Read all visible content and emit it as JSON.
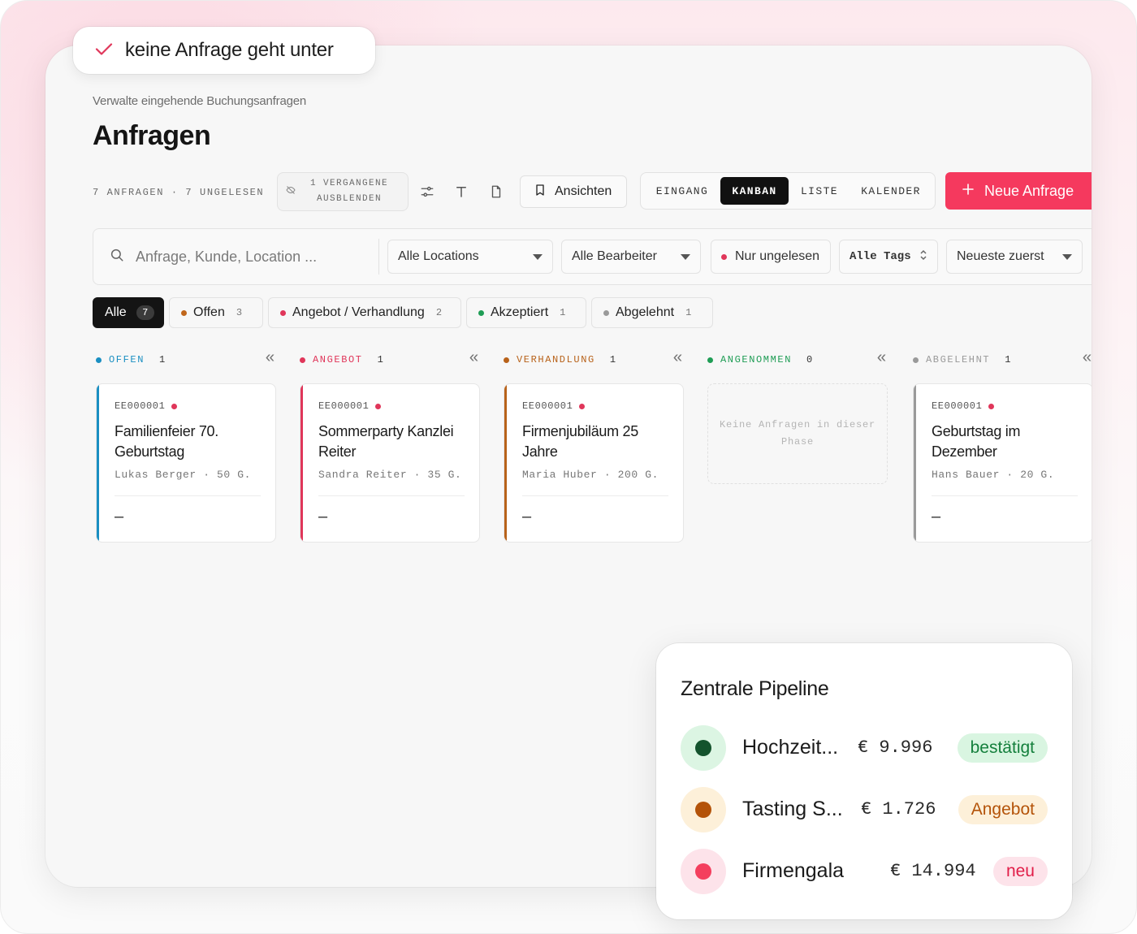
{
  "badge": {
    "text": "keine Anfrage geht unter"
  },
  "header": {
    "subtitle": "Verwalte eingehende Buchungsanfragen",
    "title": "Anfragen"
  },
  "toolbar": {
    "counts": "7 ANFRAGEN · 7 UNGELESEN",
    "hide_past": "1 VERGANGENE\nAUSBLENDEN",
    "views_label": "Ansichten",
    "tabs": [
      "EINGANG",
      "KANBAN",
      "LISTE",
      "KALENDER"
    ],
    "active_tab": "KANBAN",
    "new_label": "Neue Anfrage"
  },
  "filters": {
    "search_placeholder": "Anfrage, Kunde, Location ...",
    "location": "Alle Locations",
    "editor": "Alle Bearbeiter",
    "unread": "Nur ungelesen",
    "tags": "Alle Tags",
    "sort": "Neueste zuerst"
  },
  "chips": [
    {
      "label": "Alle",
      "count": "7",
      "color": ""
    },
    {
      "label": "Offen",
      "count": "3",
      "color": "#c0661b"
    },
    {
      "label": "Angebot / Verhandlung",
      "count": "2",
      "color": "#e0365a"
    },
    {
      "label": "Akzeptiert",
      "count": "1",
      "color": "#1f9d55"
    },
    {
      "label": "Abgelehnt",
      "count": "1",
      "color": "#9a9a9a"
    }
  ],
  "columns": [
    {
      "name": "OFFEN",
      "count": "1",
      "color": "#1a8fc2",
      "card": {
        "id": "EE000001",
        "title": "Familienfeier 70. Geburtstag",
        "meta": "Lukas Berger · 50 G.",
        "footer": "–"
      }
    },
    {
      "name": "ANGEBOT",
      "count": "1",
      "color": "#e0365a",
      "card": {
        "id": "EE000001",
        "title": "Sommerparty Kanzlei Reiter",
        "meta": "Sandra Reiter · 35 G.",
        "footer": "–"
      }
    },
    {
      "name": "VERHANDLUNG",
      "count": "1",
      "color": "#b8621a",
      "card": {
        "id": "EE000001",
        "title": "Firmenjubiläum 25 Jahre",
        "meta": "Maria Huber · 200 G.",
        "footer": "–"
      }
    },
    {
      "name": "ANGENOMMEN",
      "count": "0",
      "color": "#1f9d55",
      "empty": "Keine Anfragen in dieser Phase"
    },
    {
      "name": "ABGELEHNT",
      "count": "1",
      "color": "#9a9a9a",
      "card": {
        "id": "EE000001",
        "title": "Geburtstag im Dezember",
        "meta": "Hans Bauer · 20 G.",
        "footer": "–"
      }
    }
  ],
  "pipeline": {
    "title": "Zentrale Pipeline",
    "rows": [
      {
        "name": "Hochzeit...",
        "amount": "€ 9.996",
        "tag": "bestätigt",
        "dot": "#14532d",
        "bubble": "#dcf5e3",
        "tag_bg": "#d9f5e1",
        "tag_fg": "#15803d"
      },
      {
        "name": "Tasting S...",
        "amount": "€ 1.726",
        "tag": "Angebot",
        "dot": "#b45309",
        "bubble": "#fdf0d9",
        "tag_bg": "#fdf0d9",
        "tag_fg": "#b45309"
      },
      {
        "name": "Firmengala",
        "amount": "€ 14.994",
        "tag": "neu",
        "dot": "#f43f5e",
        "bubble": "#fde3ea",
        "tag_bg": "#fde3ea",
        "tag_fg": "#e11d48"
      }
    ]
  },
  "accent": "#f5395e"
}
